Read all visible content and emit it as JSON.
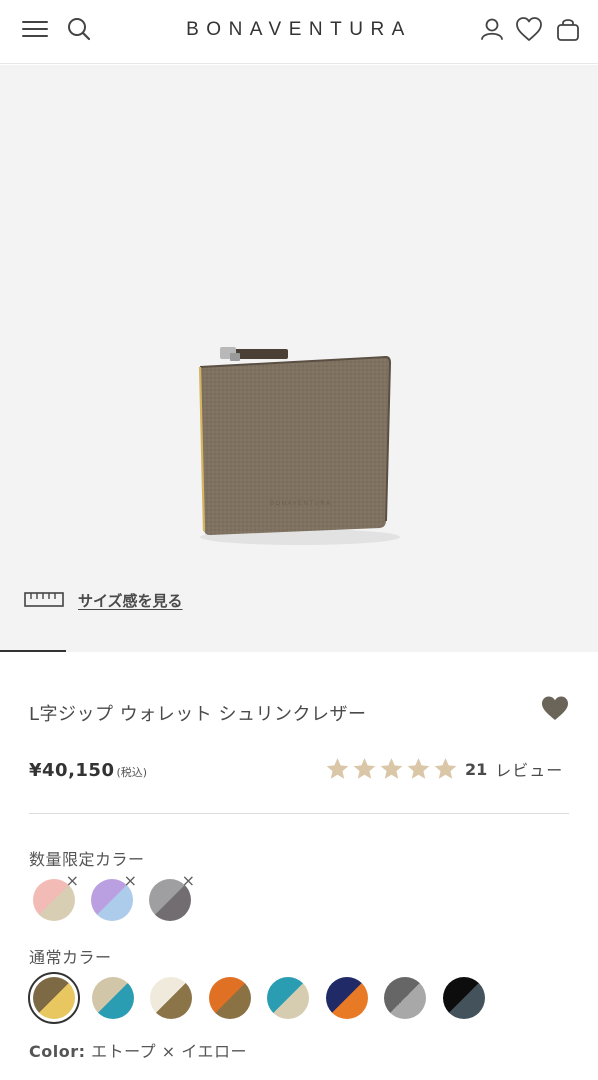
{
  "header": {
    "brand": "BONAVENTURA",
    "icons": [
      "menu-icon",
      "search-icon",
      "account-icon",
      "wishlist-icon",
      "bag-icon"
    ]
  },
  "hero": {
    "size_link_label": "サイズ感を見る",
    "slide_index": 1
  },
  "product": {
    "title": "L字ジップ ウォレット シュリンクレザー",
    "price": "¥40,150",
    "tax_note": "(税込)",
    "rating": 5,
    "review_count": "21",
    "review_label": "レビュー"
  },
  "limited_colors": {
    "label": "数量限定カラー",
    "swatches": [
      {
        "c1": "#f2b8b3",
        "c2": "#d6ccb0",
        "sold_out": true
      },
      {
        "c1": "#b79be0",
        "c2": "#a9c9ea",
        "sold_out": true
      },
      {
        "c1": "#9a9a9c",
        "c2": "#6b6669",
        "sold_out": true
      }
    ]
  },
  "regular_colors": {
    "label": "通常カラー",
    "swatches": [
      {
        "c1": "#7d6a45",
        "c2": "#e8c660",
        "selected": true
      },
      {
        "c1": "#d1c6a8",
        "c2": "#2a9db3"
      },
      {
        "c1": "#efeadb",
        "c2": "#8b7548"
      },
      {
        "c1": "#e07023",
        "c2": "#8a7244"
      },
      {
        "c1": "#2a9db3",
        "c2": "#d6ccb0"
      },
      {
        "c1": "#1f2a66",
        "c2": "#e87a26"
      },
      {
        "c1": "#666666",
        "c2": "#a8a8a8"
      },
      {
        "c1": "#0d0d0d",
        "c2": "#44535b"
      }
    ]
  },
  "selected_color": {
    "label": "Color:",
    "value": "エトープ × イエロー"
  },
  "colors": {
    "accent_heart": "#6b6459",
    "star": "#d9c7a8",
    "hero_bg": "#f3f3f3"
  }
}
